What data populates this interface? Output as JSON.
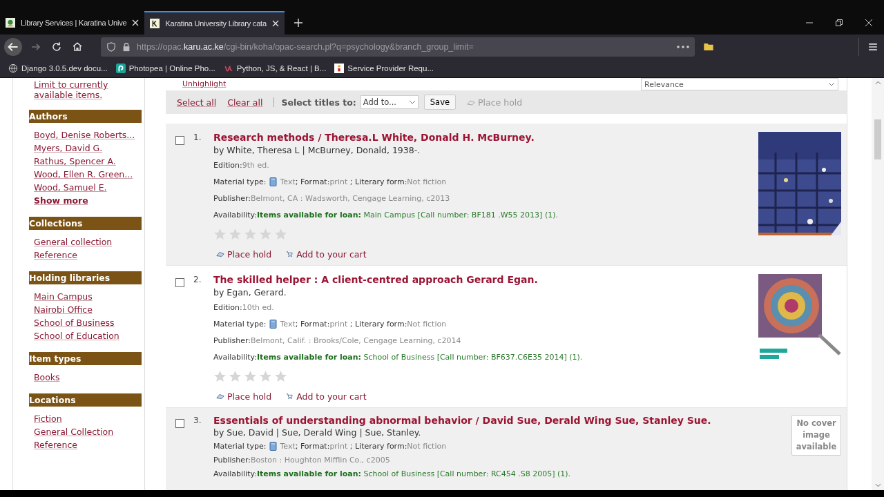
{
  "browser": {
    "tabs": [
      {
        "title": "Library Services | Karatina Unive",
        "selected": false
      },
      {
        "title": "Karatina University Library cata",
        "selected": true
      }
    ],
    "url": {
      "prefix": "https://opac.",
      "host": "karu.ac.ke",
      "rest": "/cgi-bin/koha/opac-search.pl?q=psychology&branch_group_limit="
    },
    "bookmarks": [
      "Django 3.0.5.dev docu...",
      "Photopea | Online Pho...",
      "Python, JS, & React | B...",
      "Service Provider Requ..."
    ]
  },
  "top": {
    "unhighlight": "Unhighlight",
    "sort": "Relevance"
  },
  "sidebar": {
    "limit_link": "Limit to currently available items.",
    "facets": [
      {
        "heading": "Authors",
        "items": [
          "Boyd, Denise Roberts...",
          "Myers, David G.",
          "Rathus, Spencer A.",
          "Wood, Ellen R. Green...",
          "Wood, Samuel E."
        ],
        "more": "Show more"
      },
      {
        "heading": "Collections",
        "items": [
          "General collection",
          "Reference"
        ]
      },
      {
        "heading": "Holding libraries",
        "items": [
          "Main Campus",
          "Nairobi Office",
          "School of Business",
          "School of Education"
        ]
      },
      {
        "heading": "Item types",
        "items": [
          "Books"
        ]
      },
      {
        "heading": "Locations",
        "items": [
          "Fiction",
          "General Collection",
          "Reference"
        ]
      }
    ]
  },
  "toolbar": {
    "select_all": "Select all",
    "clear_all": "Clear all",
    "select_titles": "Select titles to:",
    "add_to": "Add to...",
    "save": "Save",
    "place_hold": "Place hold"
  },
  "results": [
    {
      "number": "1.",
      "checked": false,
      "title": "Research methods / Theresa.L White, Donald H. McBurney.",
      "authors": "by White, Theresa L | McBurney, Donald, 1938-.",
      "edition": {
        "label": "Edition:",
        "value": "9th ed."
      },
      "material": [
        {
          "label": "Material type:",
          "value": "Text"
        },
        {
          "label": "; Format:",
          "value": "print"
        },
        {
          "label": " ; Literary form:",
          "value": "Not fiction"
        }
      ],
      "publisher": {
        "label": "Publisher:",
        "value": "Belmont, CA : Wadsworth, Cengage Learning, c2013"
      },
      "availability": {
        "label": "Availability:",
        "status": "Items available for loan:",
        "detail": "Main Campus [Call number: BF181 .W55 2013] (1)."
      },
      "stars": 0,
      "actions": {
        "hold": "Place hold",
        "cart": "Add to your cart"
      },
      "cover": {
        "kind": "picture"
      }
    },
    {
      "number": "2.",
      "checked": false,
      "title": "The skilled helper : A client-centred approach Gerard Egan.",
      "authors": "by Egan, Gerard.",
      "edition": {
        "label": "Edition:",
        "value": "10th ed."
      },
      "material": [
        {
          "label": "Material type:",
          "value": "Text"
        },
        {
          "label": "; Format:",
          "value": "print"
        },
        {
          "label": " ; Literary form:",
          "value": "Not fiction"
        }
      ],
      "publisher": {
        "label": "Publisher:",
        "value": "Belmont, Calif. : Brooks/Cole, Cengage Learning, c2014"
      },
      "availability": {
        "label": "Availability:",
        "status": "Items available for loan:",
        "detail": "School of Business [Call number: BF637.C6E35 2014] (1)."
      },
      "stars": 0,
      "actions": {
        "hold": "Place hold",
        "cart": "Add to your cart"
      },
      "cover": {
        "kind": "picture"
      }
    },
    {
      "number": "3.",
      "checked": false,
      "title": "Essentials of understanding abnormal behavior / David Sue, Derald Wing Sue, Stanley Sue.",
      "authors": "by Sue, David | Sue, Derald Wing | Sue, Stanley.",
      "material": [
        {
          "label": "Material type:",
          "value": "Text"
        },
        {
          "label": "; Format:",
          "value": "print"
        },
        {
          "label": " ; Literary form:",
          "value": "Not fiction"
        }
      ],
      "publisher": {
        "label": "Publisher:",
        "value": "Boston : Houghton Mifflin Co., c2005"
      },
      "availability": {
        "label": "Availability:",
        "status": "Items available for loan:",
        "detail": "School of Business [Call number: RC454 .S8 2005] (1)."
      },
      "cover": {
        "kind": "none",
        "text": "No cover image available"
      }
    }
  ]
}
